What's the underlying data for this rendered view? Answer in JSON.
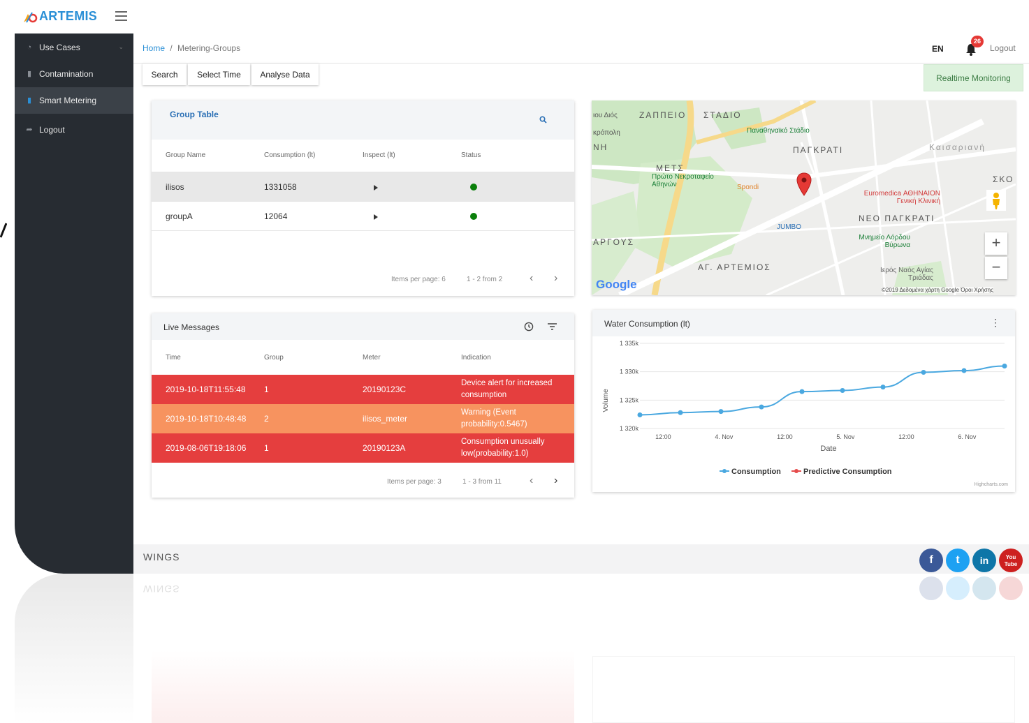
{
  "app": {
    "name": "ARTEMIS"
  },
  "sidebar": {
    "items": [
      {
        "label": "Use Cases"
      },
      {
        "label": "Contamination"
      },
      {
        "label": "Smart Metering"
      },
      {
        "label": "Logout"
      }
    ]
  },
  "breadcrumb": {
    "home": "Home",
    "separator": "/",
    "current": "Metering-Groups"
  },
  "header": {
    "language": "EN",
    "notifications": "26",
    "logout": "Logout"
  },
  "toolbar": {
    "search": "Search",
    "select_time": "Select Time",
    "analyse_data": "Analyse Data",
    "realtime": "Realtime Monitoring"
  },
  "group_table": {
    "title": "Group Table",
    "columns": [
      "Group Name",
      "Consumption (lt)",
      "Inspect (lt)",
      "Status"
    ],
    "rows": [
      {
        "name": "ilisos",
        "consumption": "1331058"
      },
      {
        "name": "groupA",
        "consumption": "12064"
      }
    ],
    "items_per_page": "Items per page: 6",
    "range": "1 - 2 from 2",
    "status_color": "#0a7f0a"
  },
  "live_messages": {
    "title": "Live Messages",
    "columns": [
      "Time",
      "Group",
      "Meter",
      "Indication"
    ],
    "rows": [
      {
        "time": "2019-10-18T11:55:48",
        "group": "1",
        "meter": "20190123C",
        "indication": "Device alert for increased consumption",
        "color": "#e53e3e"
      },
      {
        "time": "2019-10-18T10:48:48",
        "group": "2",
        "meter": "ilisos_meter",
        "indication": "Warning (Event probability:0.5467)",
        "color": "#f7935f"
      },
      {
        "time": "2019-08-06T19:18:06",
        "group": "1",
        "meter": "20190123A",
        "indication": "Consumption unusually low(probability:1.0)",
        "color": "#e53e3e"
      }
    ],
    "items_per_page": "Items per page: 3",
    "range": "1 - 3 from 11"
  },
  "map": {
    "labels": [
      "ΖΑΠΠΕΙΟ",
      "ΣΤΑΔΙΟ",
      "ΠΑΓΚΡΑΤΙ",
      "ΜΕΤΣ",
      "ΑΡΓΟΥΣ",
      "ΑΓ. ΑΡΤΕΜΙΟΣ",
      "ΝΕΟ ΠΑΓΚΡΑΤΙ",
      "Καισαριανή",
      "ΣΚΟ"
    ],
    "pois": [
      "Παναθηναϊκό Στάδιο",
      "Πρώτο Νεκροταφείο Αθηνών",
      "Spondi",
      "JUMBO",
      "Euromedica ΑΘΗΝΑΙΟΝ Γενική Κλινική",
      "Μνημείο Λόρδου Βύρωνα",
      "Ιερός Ναός Αγίας Τριάδας",
      "ιου Διός",
      "κρόπολη",
      "ΝΗ"
    ],
    "google": "Google",
    "credits": "©2019 Δεδομένα χάρτη Google   Όροι Χρήσης",
    "zoom_in": "+",
    "zoom_out": "−"
  },
  "chart_card": {
    "title": "Water Consumption (lt)",
    "menu": "⋮",
    "credit": "Highcharts.com"
  },
  "chart_data": {
    "type": "line",
    "title": "Water Consumption (lt)",
    "xlabel": "Date",
    "ylabel": "Volume",
    "ylim": [
      1320000,
      1335000
    ],
    "ytick_labels": [
      "1 320k",
      "1 325k",
      "1 330k",
      "1 335k"
    ],
    "yticks": [
      1320000,
      1325000,
      1330000,
      1335000
    ],
    "xlim": [
      0,
      90
    ],
    "xtick_labels": [
      "12:00",
      "4. Nov",
      "12:00",
      "5. Nov",
      "12:00",
      "6. Nov"
    ],
    "xticks": [
      3,
      18,
      33,
      48,
      63,
      78
    ],
    "legend": "bottom",
    "series": [
      {
        "name": "Consumption",
        "color": "#4aa8e0",
        "x": [
          0,
          10,
          20,
          30,
          40,
          50,
          60,
          70,
          80,
          90
        ],
        "values": [
          1322400,
          1322800,
          1323000,
          1323800,
          1326500,
          1326700,
          1327300,
          1329900,
          1330200,
          1331000
        ]
      },
      {
        "name": "Predictive Consumption",
        "color": "#e54b4b",
        "x": [],
        "values": []
      }
    ]
  },
  "footer": {
    "brand": "WINGS",
    "social": [
      "f",
      "t",
      "in",
      "You Tube"
    ]
  }
}
